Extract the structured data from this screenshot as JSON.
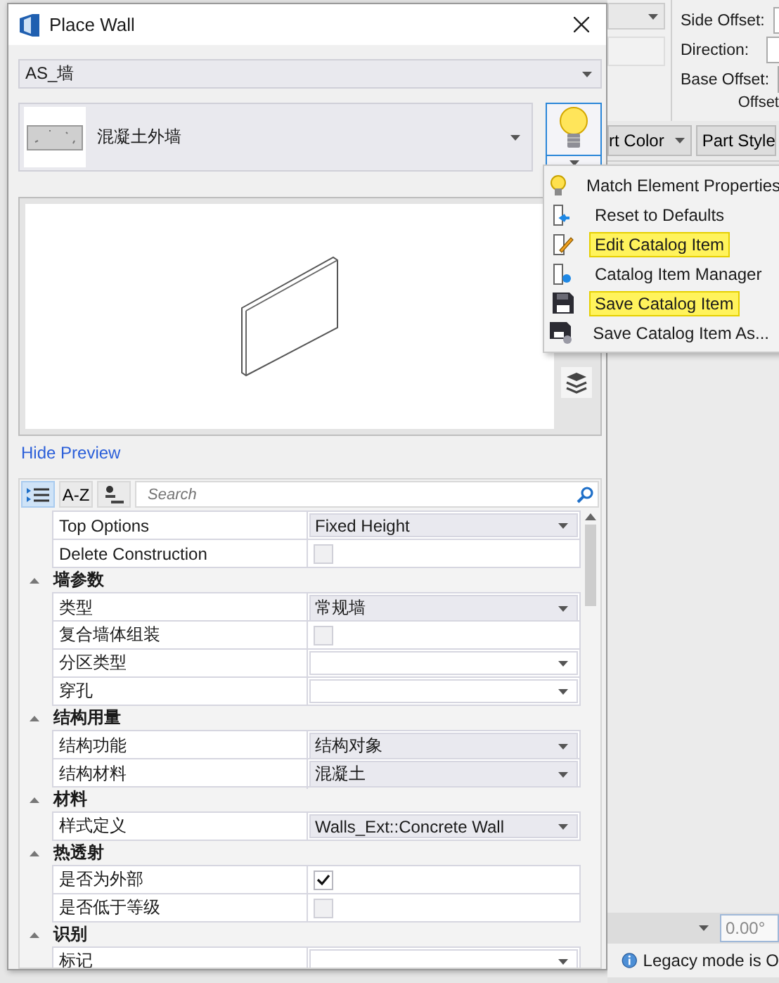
{
  "window": {
    "title": "Place Wall"
  },
  "catalog_type": {
    "value": "AS_墙"
  },
  "catalog_item": {
    "value": "混凝土外墙"
  },
  "preview_link": "Hide Preview",
  "grid_toolbar": [
    {
      "kind": "categorized",
      "selected": true
    },
    {
      "kind": "alpha",
      "label": "A-Z",
      "selected": false
    },
    {
      "kind": "filter",
      "selected": false
    }
  ],
  "search": {
    "placeholder": "Search"
  },
  "rows": [
    {
      "kind": "dropdown",
      "label": "Top Options",
      "value": "Fixed Height"
    },
    {
      "kind": "checkbox",
      "label": "Delete Construction",
      "checked": false
    },
    {
      "kind": "group",
      "label": "墙参数",
      "expanded": true
    },
    {
      "kind": "dropdown",
      "label": "类型",
      "value": "常规墙"
    },
    {
      "kind": "checkbox",
      "label": "复合墙体组装",
      "checked": false
    },
    {
      "kind": "dropdown",
      "label": "分区类型"
    },
    {
      "kind": "dropdown",
      "label": "穿孔"
    },
    {
      "kind": "group",
      "label": "结构用量",
      "expanded": true
    },
    {
      "kind": "dropdown",
      "label": "结构功能",
      "value": "结构对象"
    },
    {
      "kind": "dropdown",
      "label": "结构材料",
      "value": "混凝土"
    },
    {
      "kind": "group",
      "label": "材料",
      "expanded": true
    },
    {
      "kind": "dropdown",
      "label": "样式定义",
      "value": "Walls_Ext::Concrete Wall"
    },
    {
      "kind": "group",
      "label": "热透射",
      "expanded": true
    },
    {
      "kind": "checkbox",
      "label": "是否为外部",
      "checked": true
    },
    {
      "kind": "checkbox",
      "label": "是否低于等级",
      "checked": false
    },
    {
      "kind": "group",
      "label": "识别",
      "expanded": true
    },
    {
      "kind": "dropdown",
      "label": "标记"
    }
  ],
  "menu": {
    "items": [
      {
        "kind": "bulb",
        "label": "Match Element Properties",
        "highlighted": false
      },
      {
        "kind": "reset",
        "label": "Reset to Defaults",
        "highlighted": false
      },
      {
        "kind": "edit",
        "label": "Edit Catalog Item",
        "highlighted": true
      },
      {
        "kind": "manager",
        "label": "Catalog Item Manager",
        "highlighted": false
      },
      {
        "kind": "save",
        "label": "Save Catalog Item",
        "highlighted": true
      },
      {
        "kind": "save-as",
        "label": "Save Catalog Item As...",
        "highlighted": false
      }
    ]
  },
  "background": {
    "fields": [
      {
        "label": "Side Offset:"
      },
      {
        "label": "Direction:"
      },
      {
        "label": "Base Offset:"
      }
    ],
    "section_label": "Offset",
    "dropdowns": [
      "rt Color",
      "Part Style"
    ],
    "angle_value": "0.00°",
    "status_message": "Legacy mode is O"
  }
}
